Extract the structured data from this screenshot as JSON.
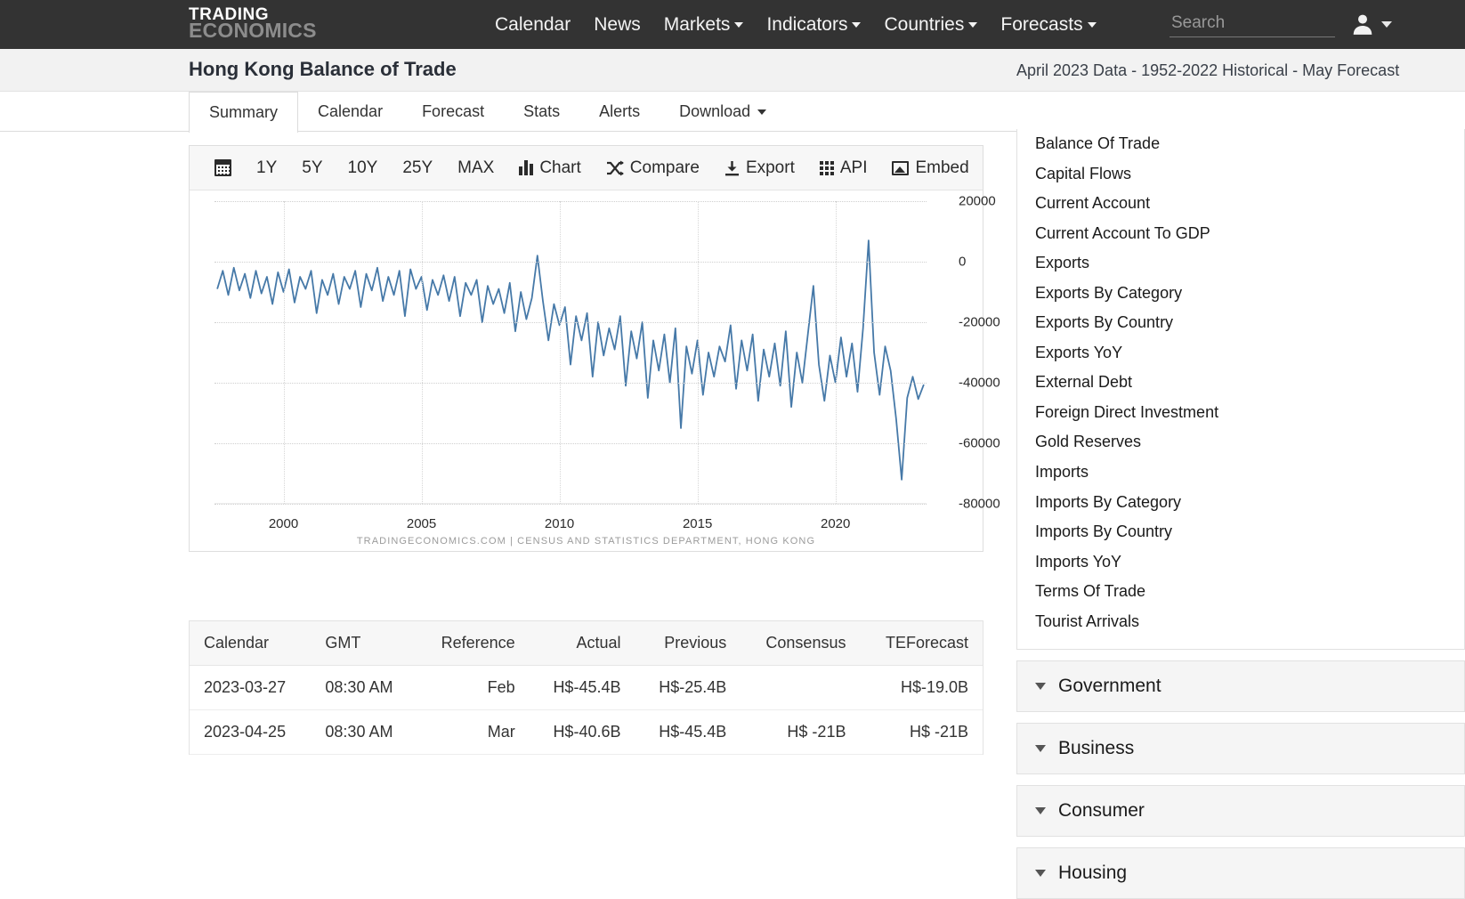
{
  "topnav": {
    "logo_line1": "TRADING",
    "logo_line2": "ECONOMICS",
    "items": [
      {
        "label": "Calendar",
        "caret": false
      },
      {
        "label": "News",
        "caret": false
      },
      {
        "label": "Markets",
        "caret": true
      },
      {
        "label": "Indicators",
        "caret": true
      },
      {
        "label": "Countries",
        "caret": true
      },
      {
        "label": "Forecasts",
        "caret": true
      }
    ],
    "search_placeholder": "Search"
  },
  "header": {
    "title": "Hong Kong Balance of Trade",
    "subtitle": "April 2023 Data - 1952-2022 Historical - May Forecast"
  },
  "tabs": [
    {
      "label": "Summary",
      "active": true,
      "caret": false
    },
    {
      "label": "Calendar",
      "active": false,
      "caret": false
    },
    {
      "label": "Forecast",
      "active": false,
      "caret": false
    },
    {
      "label": "Stats",
      "active": false,
      "caret": false
    },
    {
      "label": "Alerts",
      "active": false,
      "caret": false
    },
    {
      "label": "Download",
      "active": false,
      "caret": true
    }
  ],
  "chart_toolbar": [
    {
      "label": "",
      "icon": "calendar-icon"
    },
    {
      "label": "1Y",
      "icon": ""
    },
    {
      "label": "5Y",
      "icon": ""
    },
    {
      "label": "10Y",
      "icon": ""
    },
    {
      "label": "25Y",
      "icon": ""
    },
    {
      "label": "MAX",
      "icon": ""
    },
    {
      "label": "Chart",
      "icon": "bar-chart-icon"
    },
    {
      "label": "Compare",
      "icon": "shuffle-icon"
    },
    {
      "label": "Export",
      "icon": "download-icon"
    },
    {
      "label": "API",
      "icon": "grid-icon"
    },
    {
      "label": "Embed",
      "icon": "image-icon"
    }
  ],
  "chart_data": {
    "type": "line",
    "title": "",
    "xlabel": "",
    "ylabel": "",
    "xlim": [
      1997.5,
      2023.3
    ],
    "ylim": [
      -80000,
      20000
    ],
    "xticks": [
      2000,
      2005,
      2010,
      2015,
      2020
    ],
    "yticks": [
      20000,
      0,
      -20000,
      -40000,
      -60000,
      -80000
    ],
    "grid": true,
    "legend": "none",
    "line_color": "#4679a8",
    "attribution": "TRADINGECONOMICS.COM  |  CENSUS AND STATISTICS DEPARTMENT, HONG KONG",
    "series": [
      {
        "name": "Hong Kong Balance of Trade",
        "x": [
          1997.6,
          1997.8,
          1998.0,
          1998.2,
          1998.4,
          1998.6,
          1998.8,
          1999.0,
          1999.2,
          1999.4,
          1999.6,
          1999.8,
          2000.0,
          2000.2,
          2000.4,
          2000.6,
          2000.8,
          2001.0,
          2001.2,
          2001.4,
          2001.6,
          2001.8,
          2002.0,
          2002.2,
          2002.4,
          2002.6,
          2002.8,
          2003.0,
          2003.2,
          2003.4,
          2003.6,
          2003.8,
          2004.0,
          2004.2,
          2004.4,
          2004.6,
          2004.8,
          2005.0,
          2005.2,
          2005.4,
          2005.6,
          2005.8,
          2006.0,
          2006.2,
          2006.4,
          2006.6,
          2006.8,
          2007.0,
          2007.2,
          2007.4,
          2007.6,
          2007.8,
          2008.0,
          2008.2,
          2008.4,
          2008.6,
          2008.8,
          2009.0,
          2009.2,
          2009.4,
          2009.6,
          2009.8,
          2010.0,
          2010.2,
          2010.4,
          2010.6,
          2010.8,
          2011.0,
          2011.2,
          2011.4,
          2011.6,
          2011.8,
          2012.0,
          2012.2,
          2012.4,
          2012.6,
          2012.8,
          2013.0,
          2013.2,
          2013.4,
          2013.6,
          2013.8,
          2014.0,
          2014.2,
          2014.4,
          2014.6,
          2014.8,
          2015.0,
          2015.2,
          2015.4,
          2015.6,
          2015.8,
          2016.0,
          2016.2,
          2016.4,
          2016.6,
          2016.8,
          2017.0,
          2017.2,
          2017.4,
          2017.6,
          2017.8,
          2018.0,
          2018.2,
          2018.4,
          2018.6,
          2018.8,
          2019.0,
          2019.2,
          2019.4,
          2019.6,
          2019.8,
          2020.0,
          2020.2,
          2020.4,
          2020.6,
          2020.8,
          2021.0,
          2021.2,
          2021.4,
          2021.6,
          2021.8,
          2022.0,
          2022.2,
          2022.4,
          2022.6,
          2022.8,
          2023.0,
          2023.2
        ],
        "y": [
          -9000,
          -3000,
          -11000,
          -2000,
          -9500,
          -4000,
          -12000,
          -3000,
          -10500,
          -5000,
          -14000,
          -3500,
          -10000,
          -2500,
          -13500,
          -5000,
          -9000,
          -3000,
          -17000,
          -6000,
          -11000,
          -4000,
          -14000,
          -5000,
          -9000,
          -3000,
          -15000,
          -4000,
          -9500,
          -2000,
          -13000,
          -5000,
          -11000,
          -3000,
          -18000,
          -2500,
          -9000,
          -5000,
          -16000,
          -6000,
          -11000,
          -4500,
          -13000,
          -5000,
          -18000,
          -7000,
          -11000,
          -6000,
          -20000,
          -8000,
          -14000,
          -9000,
          -17000,
          -7000,
          -23000,
          -10000,
          -19000,
          -12000,
          2000,
          -13000,
          -26000,
          -14000,
          -21000,
          -15000,
          -34000,
          -18000,
          -26000,
          -17000,
          -38000,
          -20000,
          -31000,
          -22000,
          -29000,
          -18000,
          -41000,
          -23000,
          -32000,
          -20000,
          -45000,
          -26000,
          -36000,
          -24000,
          -40000,
          -22000,
          -55000,
          -28000,
          -37000,
          -26000,
          -44000,
          -30000,
          -38000,
          -28000,
          -33000,
          -21000,
          -42000,
          -26000,
          -36000,
          -24000,
          -46000,
          -29000,
          -38000,
          -27000,
          -41000,
          -23000,
          -48000,
          -30000,
          -40000,
          -24000,
          -8000,
          -34000,
          -46000,
          -31000,
          -40000,
          -25000,
          -38000,
          -27000,
          -43000,
          -22000,
          7000,
          -30000,
          -44000,
          -28000,
          -36000,
          -52000,
          -72000,
          -45000,
          -38000,
          -45400,
          -40600
        ]
      }
    ]
  },
  "table": {
    "columns": [
      "Calendar",
      "GMT",
      "Reference",
      "Actual",
      "Previous",
      "Consensus",
      "TEForecast"
    ],
    "rows": [
      [
        "2023-03-27",
        "08:30 AM",
        "Feb",
        "H$-45.4B",
        "H$-25.4B",
        "",
        "H$-19.0B"
      ],
      [
        "2023-04-25",
        "08:30 AM",
        "Mar",
        "H$-40.6B",
        "H$-45.4B",
        "H$ -21B",
        "H$ -21B"
      ]
    ]
  },
  "sidebar": {
    "links": [
      "Balance Of Trade",
      "Capital Flows",
      "Current Account",
      "Current Account To GDP",
      "Exports",
      "Exports By Category",
      "Exports By Country",
      "Exports YoY",
      "External Debt",
      "Foreign Direct Investment",
      "Gold Reserves",
      "Imports",
      "Imports By Category",
      "Imports By Country",
      "Imports YoY",
      "Terms Of Trade",
      "Tourist Arrivals"
    ],
    "accordions": [
      "Government",
      "Business",
      "Consumer",
      "Housing"
    ]
  }
}
